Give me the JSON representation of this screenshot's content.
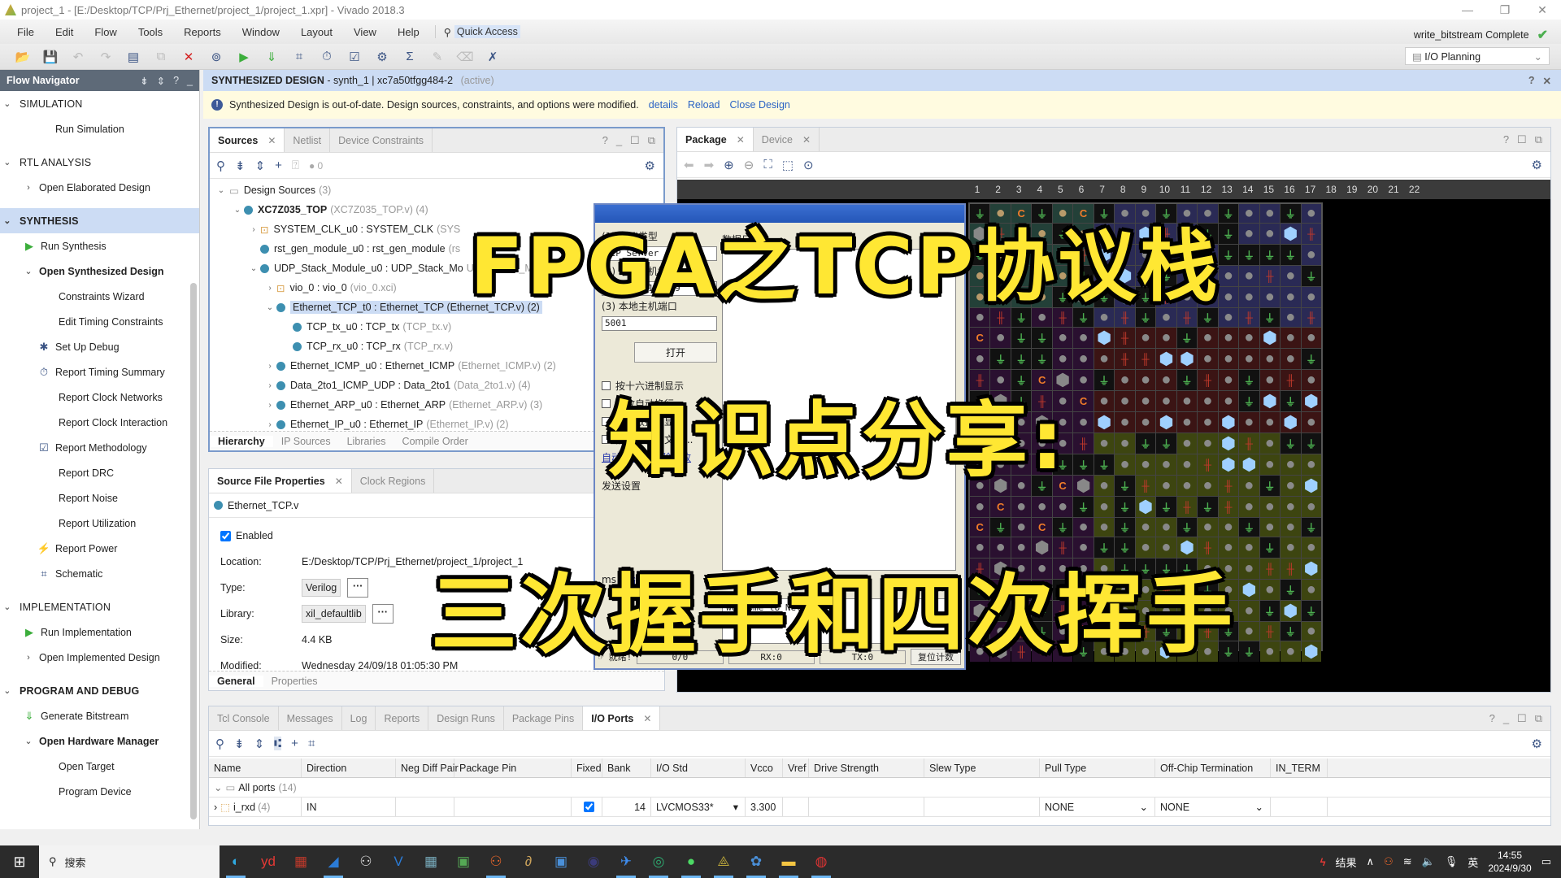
{
  "window": {
    "title": "project_1 - [E:/Desktop/TCP/Prj_Ethernet/project_1/project_1.xpr] - Vivado 2018.3",
    "controls": [
      "—",
      "❐",
      "✕"
    ]
  },
  "menu": [
    "File",
    "Edit",
    "Flow",
    "Tools",
    "Reports",
    "Window",
    "Layout",
    "View",
    "Help"
  ],
  "quick_access": {
    "icon": "search-icon",
    "label": "Quick Access"
  },
  "status": {
    "text": "write_bitstream Complete",
    "icon": "check-icon"
  },
  "layout_select": {
    "value": "I/O Planning"
  },
  "toolbar": [
    {
      "name": "open-project",
      "glyph": "📂",
      "disabled": false
    },
    {
      "name": "save",
      "glyph": "💾",
      "disabled": true
    },
    {
      "name": "undo",
      "glyph": "↶",
      "disabled": true
    },
    {
      "name": "redo",
      "glyph": "↷",
      "disabled": true
    },
    {
      "name": "report",
      "glyph": "▤",
      "disabled": false
    },
    {
      "name": "copy",
      "glyph": "⧉",
      "disabled": true
    },
    {
      "name": "cancel",
      "glyph": "✕",
      "disabled": false,
      "color": "#d42020"
    },
    {
      "name": "binoculars",
      "glyph": "⊚",
      "disabled": false
    },
    {
      "name": "run",
      "glyph": "▶",
      "disabled": false,
      "color": "#3cae3c"
    },
    {
      "name": "generate-bitstream",
      "glyph": "⇓",
      "disabled": false,
      "color": "#3cae3c"
    },
    {
      "name": "schematic",
      "glyph": "⌗",
      "disabled": false
    },
    {
      "name": "timing",
      "glyph": "⏱",
      "disabled": false
    },
    {
      "name": "methodology",
      "glyph": "☑",
      "disabled": false
    },
    {
      "name": "settings",
      "glyph": "⚙",
      "disabled": false
    },
    {
      "name": "sigma",
      "glyph": "Σ",
      "disabled": false
    },
    {
      "name": "wand",
      "glyph": "✎",
      "disabled": true
    },
    {
      "name": "eraser",
      "glyph": "⌫",
      "disabled": true
    },
    {
      "name": "probe",
      "glyph": "✗",
      "disabled": false
    }
  ],
  "flow_navigator": {
    "title": "Flow Navigator",
    "sections": [
      {
        "label": "SIMULATION",
        "active": false,
        "items": [
          {
            "label": "Run Simulation",
            "level": 2
          }
        ]
      },
      {
        "label": "RTL ANALYSIS",
        "active": false,
        "items": [
          {
            "label": "Open Elaborated Design",
            "level": 1,
            "caret": "›"
          }
        ]
      },
      {
        "label": "SYNTHESIS",
        "active": true,
        "items": [
          {
            "label": "Run Synthesis",
            "level": 1,
            "icon": "▶",
            "iconColor": "#3cae3c"
          },
          {
            "label": "Open Synthesized Design",
            "level": 1,
            "caret": "⌄",
            "bold": true
          },
          {
            "label": "Constraints Wizard",
            "level": 3
          },
          {
            "label": "Edit Timing Constraints",
            "level": 3
          },
          {
            "label": "Set Up Debug",
            "level": 2,
            "icon": "✱",
            "iconColor": "#3b5484"
          },
          {
            "label": "Report Timing Summary",
            "level": 2,
            "icon": "⏱",
            "iconColor": "#3b5484"
          },
          {
            "label": "Report Clock Networks",
            "level": 3
          },
          {
            "label": "Report Clock Interaction",
            "level": 3
          },
          {
            "label": "Report Methodology",
            "level": 2,
            "icon": "☑",
            "iconColor": "#3b5484"
          },
          {
            "label": "Report DRC",
            "level": 3
          },
          {
            "label": "Report Noise",
            "level": 3
          },
          {
            "label": "Report Utilization",
            "level": 3
          },
          {
            "label": "Report Power",
            "level": 2,
            "icon": "⚡",
            "iconColor": "#3b5484"
          },
          {
            "label": "Schematic",
            "level": 2,
            "icon": "⌗",
            "iconColor": "#3b5484"
          }
        ]
      },
      {
        "label": "IMPLEMENTATION",
        "active": false,
        "items": [
          {
            "label": "Run Implementation",
            "level": 1,
            "icon": "▶",
            "iconColor": "#3cae3c"
          },
          {
            "label": "Open Implemented Design",
            "level": 1,
            "caret": "›"
          }
        ]
      },
      {
        "label": "PROGRAM AND DEBUG",
        "active": false,
        "bold": true,
        "items": [
          {
            "label": "Generate Bitstream",
            "level": 1,
            "icon": "⇓",
            "iconColor": "#3cae3c"
          },
          {
            "label": "Open Hardware Manager",
            "level": 1,
            "caret": "⌄",
            "bold": true
          },
          {
            "label": "Open Target",
            "level": 3
          },
          {
            "label": "Program Device",
            "level": 3
          }
        ]
      }
    ]
  },
  "design_header": {
    "title": "SYNTHESIZED DESIGN",
    "detail": " - synth_1 | xc7a50tfgg484-2",
    "state": "(active)"
  },
  "banner": {
    "message": "Synthesized Design is out-of-date. Design sources, constraints, and options were modified.",
    "links": [
      "details",
      "Reload",
      "Close Design"
    ]
  },
  "sources": {
    "tabs": [
      {
        "label": "Sources",
        "active": true,
        "closable": true
      },
      {
        "label": "Netlist",
        "active": false
      },
      {
        "label": "Device Constraints",
        "active": false
      }
    ],
    "badge_count": "0",
    "tree": [
      {
        "indent": 0,
        "caret": "⌄",
        "icon": "folder",
        "name": "Design Sources",
        "extra": "(3)"
      },
      {
        "indent": 1,
        "caret": "⌄",
        "icon": "dot",
        "name": "XC7Z035_TOP",
        "extra": "(XC7Z035_TOP.v) (4)",
        "bold": true
      },
      {
        "indent": 2,
        "caret": "›",
        "icon": "ip",
        "name": "SYSTEM_CLK_u0 : SYSTEM_CLK",
        "extra": "(SYS"
      },
      {
        "indent": 2,
        "caret": "",
        "icon": "dot",
        "name": "rst_gen_module_u0 : rst_gen_module",
        "extra": "(rs"
      },
      {
        "indent": 2,
        "caret": "⌄",
        "icon": "dot",
        "name": "UDP_Stack_Module_u0 : UDP_Stack_Mo",
        "extra": "UDP_Stack_Mo"
      },
      {
        "indent": 3,
        "caret": "›",
        "icon": "ip",
        "name": "vio_0 : vio_0",
        "extra": "(vio_0.xci)"
      },
      {
        "indent": 3,
        "caret": "⌄",
        "icon": "dot",
        "name": "Ethernet_TCP_t0 : Ethernet_TCP (Ethernet_TCP.v) (2)",
        "extra": "",
        "selected": true
      },
      {
        "indent": 4,
        "caret": "",
        "icon": "dot",
        "name": "TCP_tx_u0 : TCP_tx",
        "extra": "(TCP_tx.v)"
      },
      {
        "indent": 4,
        "caret": "",
        "icon": "dot",
        "name": "TCP_rx_u0 : TCP_rx",
        "extra": "(TCP_rx.v)"
      },
      {
        "indent": 3,
        "caret": "›",
        "icon": "dot",
        "name": "Ethernet_ICMP_u0 : Ethernet_ICMP",
        "extra": "(Ethernet_ICMP.v) (2)"
      },
      {
        "indent": 3,
        "caret": "›",
        "icon": "dot",
        "name": "Data_2to1_ICMP_UDP : Data_2to1",
        "extra": "(Data_2to1.v) (4)"
      },
      {
        "indent": 3,
        "caret": "›",
        "icon": "dot",
        "name": "Ethernet_ARP_u0 : Ethernet_ARP",
        "extra": "(Ethernet_ARP.v) (3)"
      },
      {
        "indent": 3,
        "caret": "›",
        "icon": "dot",
        "name": "Ethernet_IP_u0 : Ethernet_IP",
        "extra": "(Ethernet_IP.v) (2)"
      }
    ],
    "bottom_tabs": [
      {
        "label": "Hierarchy",
        "active": true
      },
      {
        "label": "IP Sources"
      },
      {
        "label": "Libraries"
      },
      {
        "label": "Compile Order"
      }
    ]
  },
  "properties": {
    "tabs": [
      {
        "label": "Source File Properties",
        "active": true,
        "closable": true
      },
      {
        "label": "Clock Regions"
      }
    ],
    "file": "Ethernet_TCP.v",
    "enabled_label": "Enabled",
    "enabled": true,
    "rows": [
      {
        "label": "Location:",
        "value": "E:/Desktop/TCP/Prj_Ethernet/project_1/project_1"
      },
      {
        "label": "Type:",
        "value": "Verilog",
        "field": true
      },
      {
        "label": "Library:",
        "value": "xil_defaultlib",
        "field": true
      },
      {
        "label": "Size:",
        "value": "4.4 KB"
      },
      {
        "label": "Modified:",
        "value": "Wednesday 24/09/18 01:05:30 PM"
      }
    ],
    "bottom_tabs": [
      {
        "label": "General",
        "active": true
      },
      {
        "label": "Properties"
      }
    ]
  },
  "package": {
    "tabs": [
      {
        "label": "Package",
        "active": true,
        "closable": true
      },
      {
        "label": "Device",
        "closable": true
      }
    ],
    "columns": [
      "1",
      "2",
      "3",
      "4",
      "5",
      "6",
      "7",
      "8",
      "9",
      "10",
      "11",
      "12",
      "13",
      "14",
      "15",
      "16",
      "17",
      "18",
      "19",
      "20",
      "21",
      "22"
    ]
  },
  "tcp_tool": {
    "type_label": "(1) 协议类型",
    "type_value": "TCP Server",
    "addr_label": "(2) 本地主机地址",
    "addr_value": "192.168.100.99",
    "port_label": "(3) 本地主机端口",
    "port_value": "5001",
    "open_btn": "打开",
    "recv_options": [
      "按十六进制显示",
      "接收自动换行",
      "接收数据不显示",
      "接收保存到文件..."
    ],
    "recv_links": [
      "自动滚屏",
      "清除接收"
    ],
    "log_label": "数据日志",
    "send_group": "发送设置",
    "send_link": "发送",
    "clear_btn": "清除",
    "send_text": "Welcome to NetAssist",
    "interval_unit": "ms",
    "status": {
      "ready": "就绪!",
      "count": "0/0",
      "rx": "RX:0",
      "tx": "TX:0",
      "reset": "复位计数"
    }
  },
  "bottom_panel": {
    "tabs": [
      {
        "label": "Tcl Console"
      },
      {
        "label": "Messages"
      },
      {
        "label": "Log"
      },
      {
        "label": "Reports"
      },
      {
        "label": "Design Runs"
      },
      {
        "label": "Package Pins"
      },
      {
        "label": "I/O Ports",
        "active": true,
        "closable": true
      }
    ],
    "columns": [
      {
        "label": "Name",
        "w": 114
      },
      {
        "label": "Direction",
        "w": 116
      },
      {
        "label": "Neg Diff Pair",
        "w": 72
      },
      {
        "label": "Package Pin",
        "w": 144
      },
      {
        "label": "Fixed",
        "w": 38
      },
      {
        "label": "Bank",
        "w": 60
      },
      {
        "label": "I/O Std",
        "w": 116
      },
      {
        "label": "Vcco",
        "w": 46
      },
      {
        "label": "Vref",
        "w": 32
      },
      {
        "label": "Drive Strength",
        "w": 142
      },
      {
        "label": "Slew Type",
        "w": 142
      },
      {
        "label": "Pull Type",
        "w": 142
      },
      {
        "label": "Off-Chip Termination",
        "w": 142
      },
      {
        "label": "IN_TERM",
        "w": 70
      }
    ],
    "group": {
      "label": "All ports",
      "count": "(14)"
    },
    "rows": [
      {
        "name": "i_rxd",
        "count": "(4)",
        "direction": "IN",
        "neg_diff": "",
        "pin": "",
        "fixed": true,
        "bank": "14",
        "iostd": "LVCMOS33*",
        "vcco": "3.300",
        "vref": "",
        "drive": "",
        "slew": "",
        "pull": "NONE",
        "term": "NONE",
        "in_term": ""
      }
    ]
  },
  "taskbar": {
    "search_placeholder": "搜索",
    "apps": [
      {
        "name": "edge",
        "glyph": "◐",
        "color": "#2fa9e0",
        "running": true
      },
      {
        "name": "youdao",
        "glyph": "yd",
        "color": "#e53935",
        "running": false
      },
      {
        "name": "pdf-tool",
        "glyph": "▦",
        "color": "#c0392b",
        "running": false
      },
      {
        "name": "wireshark",
        "glyph": "◢",
        "color": "#2b7bd6",
        "running": true
      },
      {
        "name": "network-app",
        "glyph": "⚇",
        "color": "#ddd",
        "running": false
      },
      {
        "name": "visual-studio",
        "glyph": "V",
        "color": "#2b7bd6",
        "running": false
      },
      {
        "name": "calculator",
        "glyph": "▦",
        "color": "#7ab",
        "running": false
      },
      {
        "name": "terminal",
        "glyph": "▣",
        "color": "#5a5",
        "running": false
      },
      {
        "name": "vivado",
        "glyph": "⚇",
        "color": "#e8662a",
        "running": true
      },
      {
        "name": "app-d",
        "glyph": "∂",
        "color": "#c9a15a",
        "running": false
      },
      {
        "name": "window-app",
        "glyph": "▣",
        "color": "#4a90d9",
        "running": false
      },
      {
        "name": "eclipse",
        "glyph": "◉",
        "color": "#3b3b7b",
        "running": false
      },
      {
        "name": "feishu",
        "glyph": "✈",
        "color": "#3f8ef0",
        "running": true
      },
      {
        "name": "app-green",
        "glyph": "◎",
        "color": "#2ea86f",
        "running": true
      },
      {
        "name": "wechat",
        "glyph": "●",
        "color": "#4cd964",
        "running": true
      },
      {
        "name": "app-yellow",
        "glyph": "⟁",
        "color": "#b7a33a",
        "running": true
      },
      {
        "name": "app-colorful",
        "glyph": "✿",
        "color": "#4a90d9",
        "running": true
      },
      {
        "name": "file-explorer",
        "glyph": "▬",
        "color": "#f4c542",
        "running": true
      },
      {
        "name": "obs",
        "glyph": "◍",
        "color": "#d33",
        "running": true
      }
    ],
    "tray": {
      "result_label": "结果",
      "ime": "英",
      "time": "14:55",
      "date": "2024/9/30"
    }
  },
  "overlay": {
    "line1": "FPGA之TCP协议栈",
    "line2": "知识点分享:",
    "line3": "三次握手和四次挥手"
  }
}
